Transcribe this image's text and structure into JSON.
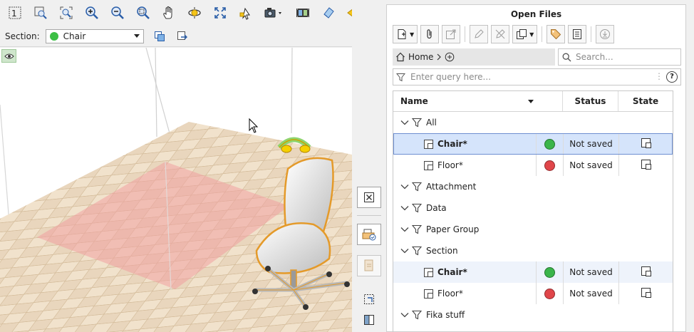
{
  "toolbar": {
    "icons": [
      "fit-1-icon",
      "zoom-window-icon",
      "zoom-extents-icon",
      "zoom-in-icon",
      "zoom-out-icon",
      "zoom-selection-icon",
      "pan-hand-icon",
      "orbit-icon",
      "fullscreen-icon",
      "pointer-add-icon",
      "camera-icon",
      "filmstrip-icon",
      "eraser-icon"
    ]
  },
  "section_bar": {
    "label": "Section:",
    "selected": "Chair",
    "selected_color": "#3cbf45"
  },
  "panel": {
    "title": "Open Files",
    "breadcrumb": {
      "home": "Home"
    },
    "search": {
      "placeholder": "Search..."
    },
    "query": {
      "placeholder": "Enter query here..."
    },
    "columns": {
      "name": "Name",
      "status": "Status",
      "state": "State"
    },
    "rows": [
      {
        "type": "group",
        "label": "All"
      },
      {
        "type": "file",
        "label": "Chair*",
        "color": "#3bb54a",
        "status": "Not saved",
        "bold": true,
        "selected": true
      },
      {
        "type": "file",
        "label": "Floor*",
        "color": "#e0464a",
        "status": "Not saved"
      },
      {
        "type": "group",
        "label": "Attachment"
      },
      {
        "type": "group",
        "label": "Data"
      },
      {
        "type": "group",
        "label": "Paper Group"
      },
      {
        "type": "group",
        "label": "Section"
      },
      {
        "type": "file",
        "label": "Chair*",
        "color": "#3bb54a",
        "status": "Not saved",
        "bold": true
      },
      {
        "type": "file",
        "label": "Floor*",
        "color": "#e0464a",
        "status": "Not saved"
      },
      {
        "type": "group",
        "label": "Fika stuff"
      }
    ]
  }
}
